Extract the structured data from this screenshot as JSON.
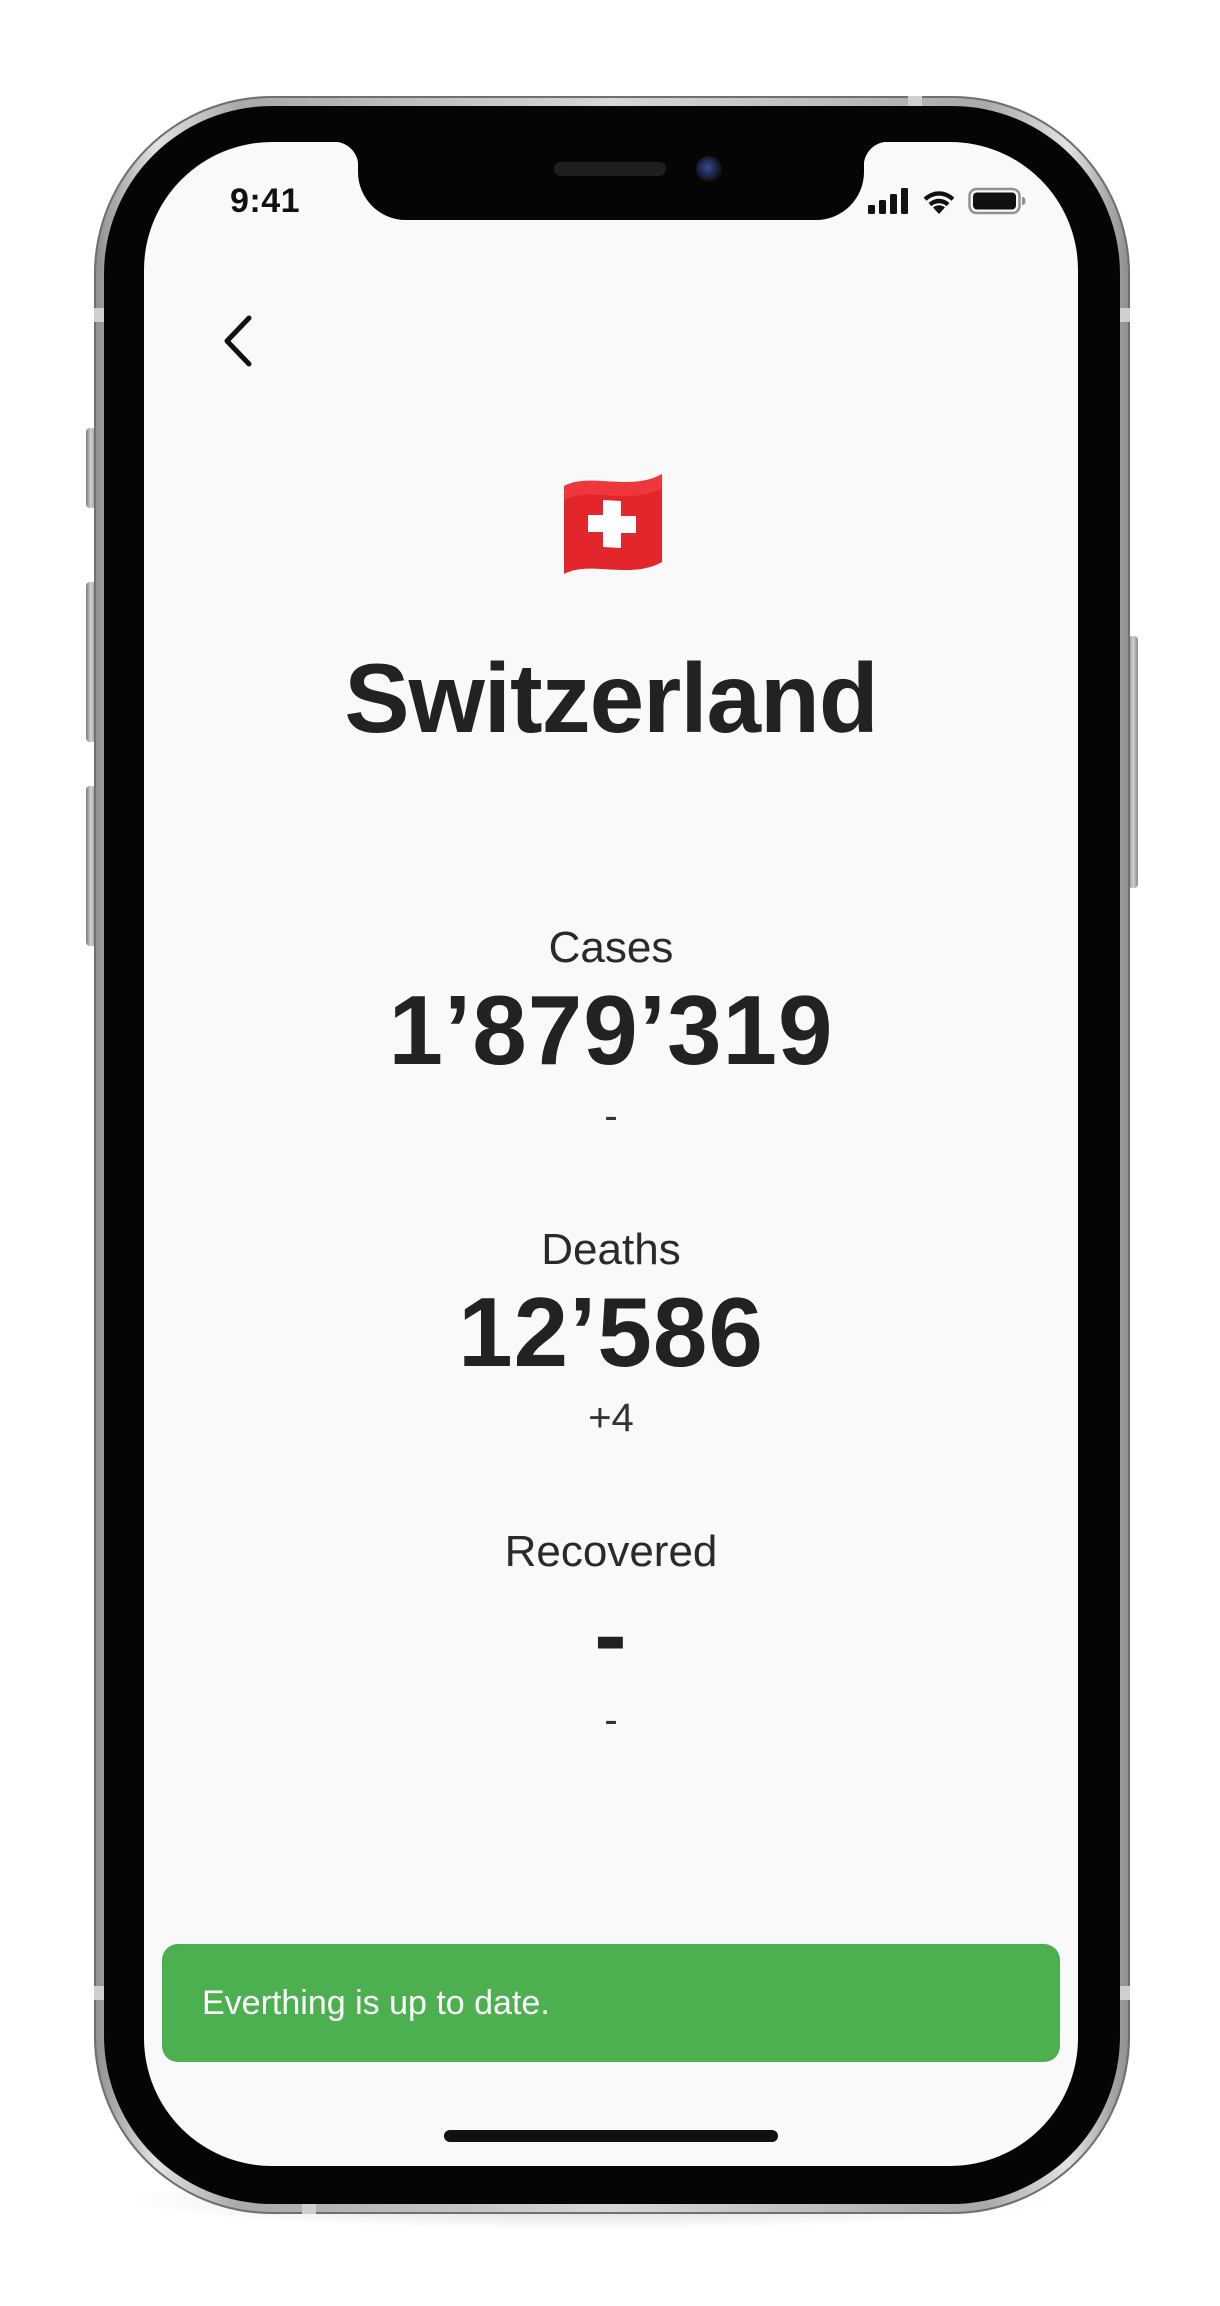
{
  "status_bar": {
    "time": "9:41",
    "icons": [
      "cellular-signal-icon",
      "wifi-icon",
      "battery-icon"
    ]
  },
  "header": {
    "back_icon": "chevron-left-icon"
  },
  "country": {
    "flag": "🇨🇭",
    "name": "Switzerland"
  },
  "stats": [
    {
      "label": "Cases",
      "value": "1’879’319",
      "delta": "-"
    },
    {
      "label": "Deaths",
      "value": "12’586",
      "delta": "+4"
    },
    {
      "label": "Recovered",
      "value": "-",
      "delta": "-"
    }
  ],
  "toast": {
    "message": "Everthing is up to date.",
    "color": "#4caf50"
  },
  "colors": {
    "background": "#f9f9f9",
    "text": "#222222",
    "flag_red": "#e3262b"
  }
}
